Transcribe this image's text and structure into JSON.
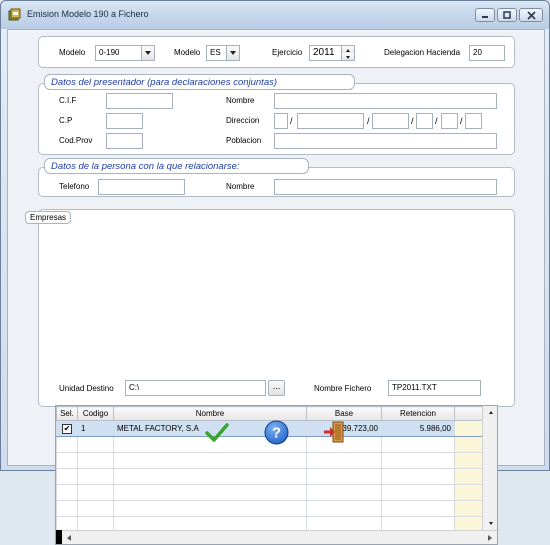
{
  "window": {
    "title": "Emision Modelo 190 a Fichero"
  },
  "top": {
    "modelo_label": "Modelo",
    "modelo_value": "0-190",
    "modelo2_label": "Modelo",
    "modelo2_value": "ES",
    "ejercicio_label": "Ejercicio",
    "ejercicio_value": "2011",
    "delegacion_label": "Delegacion Hacienda",
    "delegacion_value": "20"
  },
  "presentador": {
    "legend": "Datos del presentador (para declaraciones conjuntas)",
    "cif_label": "C.I.F",
    "cif_value": "",
    "nombre_label": "Nombre",
    "nombre_value": "",
    "cp_label": "C.P",
    "cp_value": "",
    "direccion_label": "Direccion",
    "codprov_label": "Cod.Prov",
    "codprov_value": "",
    "poblacion_label": "Poblacion",
    "poblacion_value": "",
    "separator": "/"
  },
  "relacion": {
    "legend": "Datos de la persona con la que relacionarse:",
    "telefono_label": "Telefono",
    "telefono_value": "",
    "nombre_label": "Nombre",
    "nombre_value": ""
  },
  "empresas": {
    "legend": "Empresas",
    "columns": [
      "Sel.",
      "Codigo",
      "Nombre",
      "Base",
      "Retencion"
    ],
    "rows": [
      {
        "sel": "✔",
        "codigo": "1",
        "nombre": "METAL FACTORY, S.A",
        "base": "39.723,00",
        "retencion": "5.986,00"
      }
    ],
    "unidad_label": "Unidad Destino",
    "unidad_value": "C:\\",
    "browse_label": "...",
    "fichero_label": "Nombre Fichero",
    "fichero_value": "TP2011.TXT"
  },
  "icons": {
    "accept": "checkmark-icon",
    "help": "help-icon",
    "exit": "exit-door-icon"
  },
  "colors": {
    "accent_check": "#3aa32e",
    "help_blue": "#1c5fc7",
    "legend_blue": "#1f3ea8",
    "exit_red": "#c8322b"
  }
}
